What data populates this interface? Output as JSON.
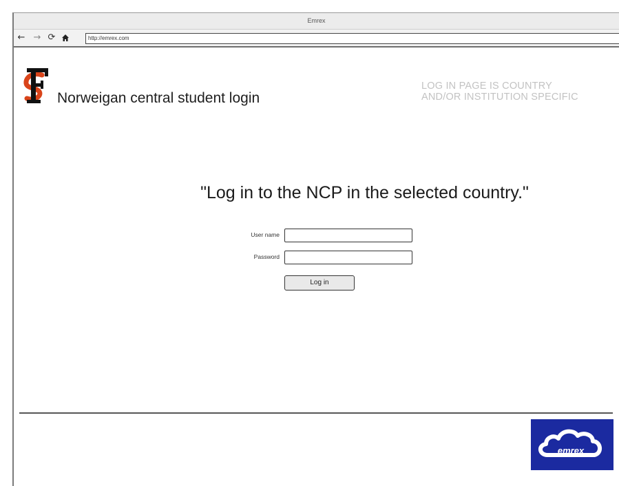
{
  "window": {
    "title": "Emrex"
  },
  "toolbar": {
    "back_icon": "arrow-left-icon",
    "forward_icon": "arrow-right-icon",
    "reload_icon": "reload-icon",
    "home_icon": "home-icon",
    "url": "http://emrex.com"
  },
  "header": {
    "logo": "FS-logo",
    "site_title": "Norweigan central student login",
    "note_line1": "LOG IN PAGE IS COUNTRY",
    "note_line2": "AND/OR INSTITUTION SPECIFIC"
  },
  "main": {
    "headline": "\"Log in to the NCP in the selected country.\""
  },
  "form": {
    "username_label": "User name",
    "username_value": "",
    "password_label": "Password",
    "password_value": "",
    "login_button": "Log in"
  },
  "footer": {
    "logo": "emrex-cloud-logo",
    "logo_text": "emrex"
  },
  "colors": {
    "footer_logo_bg": "#1b2aa0",
    "logo_red": "#d9441a",
    "note_gray": "#c2c2c2"
  }
}
